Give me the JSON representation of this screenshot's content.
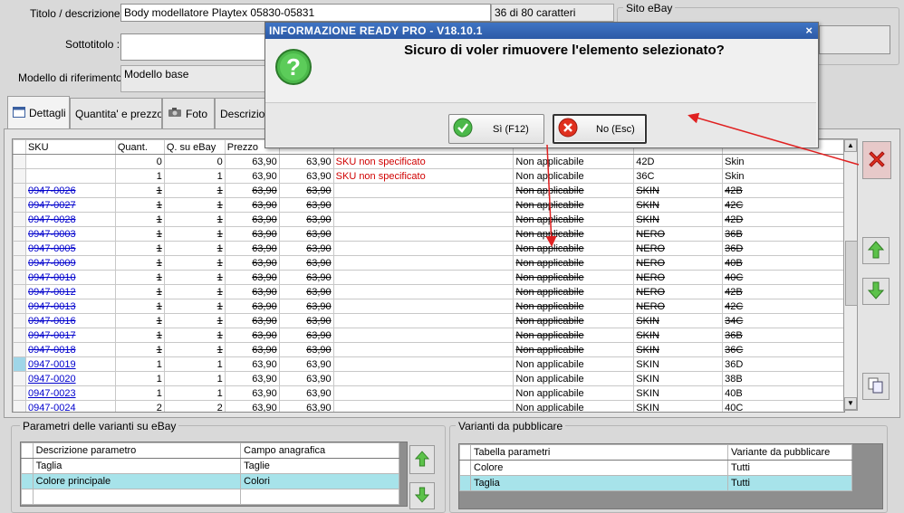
{
  "form": {
    "title_label": "Titolo / descrizione :",
    "title_value": "Body modellatore Playtex 05830-05831",
    "char_count": "36 di 80 caratteri",
    "subtitle_label": "Sottotitolo :",
    "subtitle_value": "",
    "model_label": "Modello di riferimento :",
    "model_value": "Modello base",
    "site_group_label": "Sito eBay"
  },
  "tabs": [
    {
      "label": "Dettagli",
      "icon": "details-icon"
    },
    {
      "label": "Quantita' e prezzo",
      "icon": ""
    },
    {
      "label": "Foto",
      "icon": "camera-icon"
    },
    {
      "label": "Descrizion",
      "icon": ""
    }
  ],
  "grid": {
    "headers": [
      "SKU",
      "Quant.",
      "Q. su eBay",
      "Prezzo",
      "",
      "",
      "",
      "",
      "",
      ""
    ],
    "rows": [
      {
        "sku": "",
        "q": "0",
        "qe": "0",
        "p1": "63,90",
        "p2": "63,90",
        "msg": "SKU non specificato",
        "cond": "Non applicabile",
        "c1": "42D",
        "c2": "Skin",
        "link": false,
        "deleted": false,
        "selected": false
      },
      {
        "sku": "",
        "q": "1",
        "qe": "1",
        "p1": "63,90",
        "p2": "63,90",
        "msg": "SKU non specificato",
        "cond": "Non applicabile",
        "c1": "36C",
        "c2": "Skin",
        "link": false,
        "deleted": false,
        "selected": false
      },
      {
        "sku": "0947-0026",
        "q": "1",
        "qe": "1",
        "p1": "63,90",
        "p2": "63,90",
        "msg": "",
        "cond": "Non applicabile",
        "c1": "SKIN",
        "c2": "42B",
        "link": true,
        "deleted": true,
        "selected": false
      },
      {
        "sku": "0947-0027",
        "q": "1",
        "qe": "1",
        "p1": "63,90",
        "p2": "63,90",
        "msg": "",
        "cond": "Non applicabile",
        "c1": "SKIN",
        "c2": "42C",
        "link": true,
        "deleted": true,
        "selected": false
      },
      {
        "sku": "0947-0028",
        "q": "1",
        "qe": "1",
        "p1": "63,90",
        "p2": "63,90",
        "msg": "",
        "cond": "Non applicabile",
        "c1": "SKIN",
        "c2": "42D",
        "link": true,
        "deleted": true,
        "selected": false
      },
      {
        "sku": "0947-0003",
        "q": "1",
        "qe": "1",
        "p1": "63,90",
        "p2": "63,90",
        "msg": "",
        "cond": "Non applicabile",
        "c1": "NERO",
        "c2": "36B",
        "link": true,
        "deleted": true,
        "selected": false
      },
      {
        "sku": "0947-0005",
        "q": "1",
        "qe": "1",
        "p1": "63,90",
        "p2": "63,90",
        "msg": "",
        "cond": "Non applicabile",
        "c1": "NERO",
        "c2": "36D",
        "link": true,
        "deleted": true,
        "selected": false
      },
      {
        "sku": "0947-0009",
        "q": "1",
        "qe": "1",
        "p1": "63,90",
        "p2": "63,90",
        "msg": "",
        "cond": "Non applicabile",
        "c1": "NERO",
        "c2": "40B",
        "link": true,
        "deleted": true,
        "selected": false
      },
      {
        "sku": "0947-0010",
        "q": "1",
        "qe": "1",
        "p1": "63,90",
        "p2": "63,90",
        "msg": "",
        "cond": "Non applicabile",
        "c1": "NERO",
        "c2": "40C",
        "link": true,
        "deleted": true,
        "selected": false
      },
      {
        "sku": "0947-0012",
        "q": "1",
        "qe": "1",
        "p1": "63,90",
        "p2": "63,90",
        "msg": "",
        "cond": "Non applicabile",
        "c1": "NERO",
        "c2": "42B",
        "link": true,
        "deleted": true,
        "selected": false
      },
      {
        "sku": "0947-0013",
        "q": "1",
        "qe": "1",
        "p1": "63,90",
        "p2": "63,90",
        "msg": "",
        "cond": "Non applicabile",
        "c1": "NERO",
        "c2": "42C",
        "link": true,
        "deleted": true,
        "selected": false
      },
      {
        "sku": "0947-0016",
        "q": "1",
        "qe": "1",
        "p1": "63,90",
        "p2": "63,90",
        "msg": "",
        "cond": "Non applicabile",
        "c1": "SKIN",
        "c2": "34C",
        "link": true,
        "deleted": true,
        "selected": false
      },
      {
        "sku": "0947-0017",
        "q": "1",
        "qe": "1",
        "p1": "63,90",
        "p2": "63,90",
        "msg": "",
        "cond": "Non applicabile",
        "c1": "SKIN",
        "c2": "36B",
        "link": true,
        "deleted": true,
        "selected": false
      },
      {
        "sku": "0947-0018",
        "q": "1",
        "qe": "1",
        "p1": "63,90",
        "p2": "63,90",
        "msg": "",
        "cond": "Non applicabile",
        "c1": "SKIN",
        "c2": "36C",
        "link": true,
        "deleted": true,
        "selected": false
      },
      {
        "sku": "0947-0019",
        "q": "1",
        "qe": "1",
        "p1": "63,90",
        "p2": "63,90",
        "msg": "",
        "cond": "Non applicabile",
        "c1": "SKIN",
        "c2": "36D",
        "link": true,
        "deleted": false,
        "selected": true
      },
      {
        "sku": "0947-0020",
        "q": "1",
        "qe": "1",
        "p1": "63,90",
        "p2": "63,90",
        "msg": "",
        "cond": "Non applicabile",
        "c1": "SKIN",
        "c2": "38B",
        "link": true,
        "deleted": false,
        "selected": false
      },
      {
        "sku": "0947-0023",
        "q": "1",
        "qe": "1",
        "p1": "63,90",
        "p2": "63,90",
        "msg": "",
        "cond": "Non applicabile",
        "c1": "SKIN",
        "c2": "40B",
        "link": true,
        "deleted": false,
        "selected": false
      },
      {
        "sku": "0947-0024",
        "q": "2",
        "qe": "2",
        "p1": "63,90",
        "p2": "63,90",
        "msg": "",
        "cond": "Non applicabile",
        "c1": "SKIN",
        "c2": "40C",
        "link": true,
        "deleted": false,
        "selected": false
      }
    ]
  },
  "variant_params": {
    "title": "Parametri delle varianti su eBay",
    "headers": [
      "Descrizione parametro",
      "Campo anagrafica"
    ],
    "rows": [
      [
        "Taglia",
        "Taglie"
      ],
      [
        "Colore principale",
        "Colori"
      ]
    ]
  },
  "publish_variants": {
    "title": "Varianti da pubblicare",
    "headers": [
      "Tabella parametri",
      "Variante da pubblicare"
    ],
    "rows": [
      [
        "Colore",
        "Tutti"
      ],
      [
        "Taglia",
        "Tutti"
      ]
    ]
  },
  "dialog": {
    "title": "INFORMAZIONE READY PRO - V18.10.1",
    "close": "×",
    "message": "Sicuro di voler rimuovere l'elemento selezionato?",
    "yes_label": "Sì (F12)",
    "no_label": "No (Esc)"
  },
  "colors": {
    "accent_title": "#2d5aa6",
    "annotation_arrow": "#e02020",
    "selected_row": "#a7e3ea",
    "error_text": "#d00000"
  }
}
